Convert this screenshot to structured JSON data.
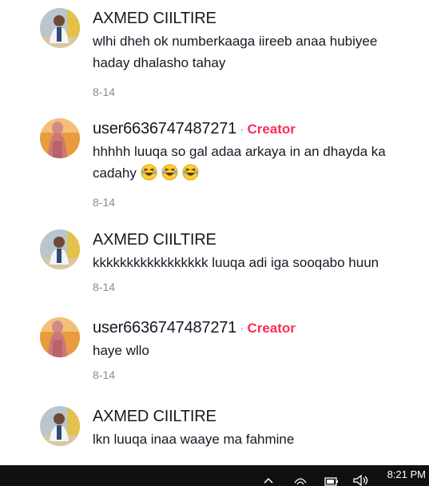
{
  "comments": [
    {
      "username": "AXMED CIILTIRE",
      "text_lines": [
        "wlhi dheh ok numberkaaga iireeb anaa hubiyee",
        "haday dhalasho tahay"
      ],
      "date": "8-14",
      "avatar": "man-avatar"
    },
    {
      "username": "user6636747487271",
      "separator": "·",
      "badge": "Creator",
      "text_lines": [
        "hhhhh luuqa so gal adaa arkaya in an dhayda ka",
        "cadahy"
      ],
      "emojis": [
        "laughing-emoji",
        "laughing-emoji",
        "laughing-emoji"
      ],
      "date": "8-14",
      "avatar": "woman-avatar"
    },
    {
      "username": "AXMED CIILTIRE",
      "text_lines": [
        "kkkkkkkkkkkkkkkkk luuqa adi iga sooqabo huun"
      ],
      "date": "8-14",
      "avatar": "man-avatar"
    },
    {
      "username": "user6636747487271",
      "separator": "·",
      "badge": "Creator",
      "text_lines": [
        "haye wllo"
      ],
      "date": "8-14",
      "avatar": "woman-avatar"
    },
    {
      "username": "AXMED CIILTIRE",
      "text_lines": [
        "lkn luuqa inaa waaye ma fahmine"
      ],
      "avatar": "man-avatar"
    }
  ],
  "taskbar": {
    "clock": "8:21 PM",
    "icons": [
      "chevron-up-icon",
      "wifi-icon",
      "battery-icon",
      "volume-icon"
    ]
  },
  "colors": {
    "creator_badge": "#fe2c55",
    "username": "#161823",
    "date": "#8a8b91",
    "taskbar": "#101010"
  }
}
